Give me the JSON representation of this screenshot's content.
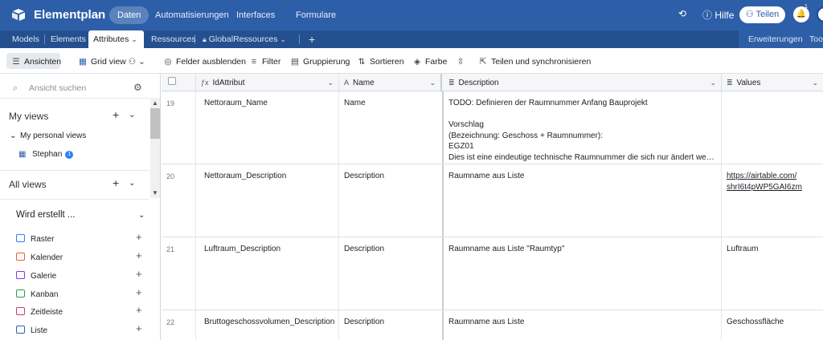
{
  "app": {
    "name": "Elementplan",
    "nav": [
      "Daten",
      "Automatisierungen",
      "Interfaces",
      "Formulare"
    ],
    "help_label": "Hilfe",
    "share_label": "Teilen",
    "notification_count": "1"
  },
  "tables": {
    "tabs": [
      "Models",
      "Elements",
      "Attributes",
      "Ressources",
      "GlobalRessources"
    ],
    "active": "Attributes",
    "right": [
      "Erweiterungen",
      "Tools"
    ]
  },
  "toolbar": {
    "views_label": "Ansichten",
    "view_name": "Grid view",
    "hide_fields": "Felder ausblenden",
    "filter": "Filter",
    "group": "Gruppierung",
    "sort": "Sortieren",
    "color": "Farbe",
    "share_sync": "Teilen und synchronisieren"
  },
  "sidebar": {
    "search_placeholder": "Ansicht suchen",
    "my_views": "My views",
    "my_personal_views": "My personal views",
    "view_item": "Stephan",
    "view_badge": "1",
    "all_views": "All views",
    "create_heading": "Wird erstellt ...",
    "create_items": [
      "Raster",
      "Kalender",
      "Galerie",
      "Kanban",
      "Zeitleiste",
      "Liste"
    ]
  },
  "grid": {
    "columns": [
      "IdAttribut",
      "Name",
      "Description",
      "Values"
    ],
    "rows": [
      {
        "num": "19",
        "id": "Nettoraum_Name",
        "name": "Name",
        "description": [
          "TODO: Definieren der Raumnummer Anfang Bauprojekt",
          "",
          "Vorschlag",
          "(Bezeichnung: Geschoss + Raumnummer):",
          "EGZ01",
          "Dies ist eine eindeutige technische Raumnummer die sich nur ändert wenn eine ..."
        ],
        "values": [
          "",
          ""
        ]
      },
      {
        "num": "20",
        "id": "Nettoraum_Description",
        "name": "Description",
        "description": [
          "Raumname aus Liste",
          "",
          "",
          "",
          "",
          ""
        ],
        "values": [
          "https://airtable.com/",
          "shrI6t4pWP5GAI6zm"
        ]
      },
      {
        "num": "21",
        "id": "Luftraum_Description",
        "name": "Description",
        "description": [
          "Raumname aus Liste \"Raumtyp\"",
          "",
          "",
          "",
          "",
          ""
        ],
        "values": [
          "Luftraum",
          ""
        ]
      },
      {
        "num": "22",
        "id": "Bruttogeschossvolumen_Description",
        "name": "Description",
        "description": [
          "Raumname aus Liste",
          "",
          "",
          "",
          "",
          ""
        ],
        "values": [
          "Geschossfläche",
          ""
        ]
      }
    ]
  },
  "colors": {
    "topbar": "#2d5fa8",
    "tabbar": "#24508f",
    "badge": "#2d7ff9"
  }
}
